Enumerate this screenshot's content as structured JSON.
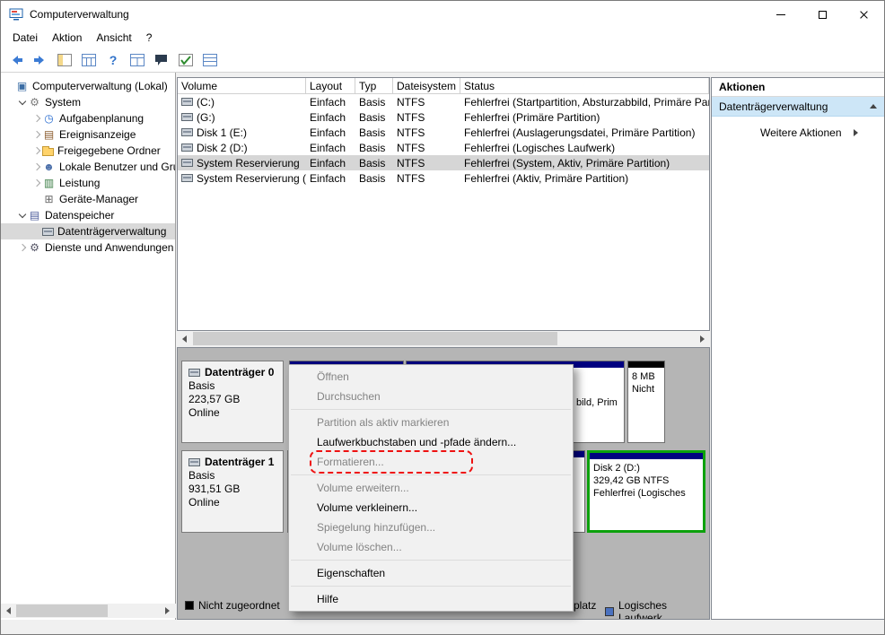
{
  "window": {
    "title": "Computerverwaltung"
  },
  "menubar": {
    "items": [
      "Datei",
      "Aktion",
      "Ansicht",
      "?"
    ]
  },
  "toolbar": {
    "help_glyph": "?"
  },
  "tree": {
    "items": [
      {
        "label": "Computerverwaltung (Lokal)",
        "icon": "computer-icon"
      },
      {
        "label": "System",
        "icon": "system-tools-icon"
      },
      {
        "label": "Aufgabenplanung",
        "icon": "clock-icon"
      },
      {
        "label": "Ereignisanzeige",
        "icon": "event-log-icon"
      },
      {
        "label": "Freigegebene Ordner",
        "icon": "folder-icon"
      },
      {
        "label": "Lokale Benutzer und Gru",
        "icon": "users-icon"
      },
      {
        "label": "Leistung",
        "icon": "performance-icon"
      },
      {
        "label": "Geräte-Manager",
        "icon": "device-manager-icon"
      },
      {
        "label": "Datenspeicher",
        "icon": "storage-icon"
      },
      {
        "label": "Datenträgerverwaltung",
        "icon": "disk-icon",
        "selected": true
      },
      {
        "label": "Dienste und Anwendungen",
        "icon": "services-icon"
      }
    ]
  },
  "volume_table": {
    "columns": [
      "Volume",
      "Layout",
      "Typ",
      "Dateisystem",
      "Status"
    ],
    "rows": [
      {
        "volume": "(C:)",
        "layout": "Einfach",
        "typ": "Basis",
        "fs": "NTFS",
        "status": "Fehlerfrei (Startpartition, Absturzabbild, Primäre Par"
      },
      {
        "volume": "(G:)",
        "layout": "Einfach",
        "typ": "Basis",
        "fs": "NTFS",
        "status": "Fehlerfrei (Primäre Partition)"
      },
      {
        "volume": "Disk 1 (E:)",
        "layout": "Einfach",
        "typ": "Basis",
        "fs": "NTFS",
        "status": "Fehlerfrei (Auslagerungsdatei, Primäre Partition)"
      },
      {
        "volume": "Disk 2 (D:)",
        "layout": "Einfach",
        "typ": "Basis",
        "fs": "NTFS",
        "status": "Fehlerfrei (Logisches Laufwerk)"
      },
      {
        "volume": "System Reservierung",
        "layout": "Einfach",
        "typ": "Basis",
        "fs": "NTFS",
        "status": "Fehlerfrei (System, Aktiv, Primäre Partition)",
        "selected": true
      },
      {
        "volume": "System Reservierung (F:)",
        "layout": "Einfach",
        "typ": "Basis",
        "fs": "NTFS",
        "status": "Fehlerfrei (Aktiv, Primäre Partition)"
      }
    ]
  },
  "context_menu": {
    "items": [
      {
        "label": "Öffnen",
        "enabled": false
      },
      {
        "label": "Durchsuchen",
        "enabled": false
      },
      {
        "label": "Partition als aktiv markieren",
        "enabled": false
      },
      {
        "label": "Laufwerkbuchstaben und -pfade ändern...",
        "enabled": true
      },
      {
        "label": "Formatieren...",
        "enabled": false,
        "highlighted": true
      },
      {
        "label": "Volume erweitern...",
        "enabled": false
      },
      {
        "label": "Volume verkleinern...",
        "enabled": true
      },
      {
        "label": "Spiegelung hinzufügen...",
        "enabled": false
      },
      {
        "label": "Volume löschen...",
        "enabled": false
      },
      {
        "label": "Eigenschaften",
        "enabled": true
      },
      {
        "label": "Hilfe",
        "enabled": true
      }
    ]
  },
  "disk_view": {
    "disks": [
      {
        "name": "Datenträger 0",
        "type": "Basis",
        "size": "223,57 GB",
        "status": "Online"
      },
      {
        "name": "Datenträger 1",
        "type": "Basis",
        "size": "931,51 GB",
        "status": "Online"
      }
    ],
    "partition_fragments": {
      "disk0_p2": "bild, Prim",
      "disk0_unalloc_line1": "8 MB",
      "disk0_unalloc_line2": "Nicht",
      "disk1_sel_line1": "Disk 2 (D:)",
      "disk1_sel_line2": "329,42 GB NTFS",
      "disk1_sel_line3": "Fehlerfrei (Logisches"
    },
    "legend": [
      {
        "label": "Nicht zugeordnet",
        "color": "#000000"
      },
      {
        "label": "platz",
        "color": ""
      },
      {
        "label": "Logisches Laufwerk",
        "color": "#4a71bf"
      }
    ]
  },
  "actions_panel": {
    "header": "Aktionen",
    "primary": "Datenträgerverwaltung",
    "secondary": "Weitere Aktionen"
  },
  "colors": {
    "partition_stripe": "#000080",
    "unallocated_stripe": "#000000",
    "selected_partition_border": "#0ca10c",
    "highlight_box": "#ee1111",
    "action_highlight": "#cde6f7"
  }
}
